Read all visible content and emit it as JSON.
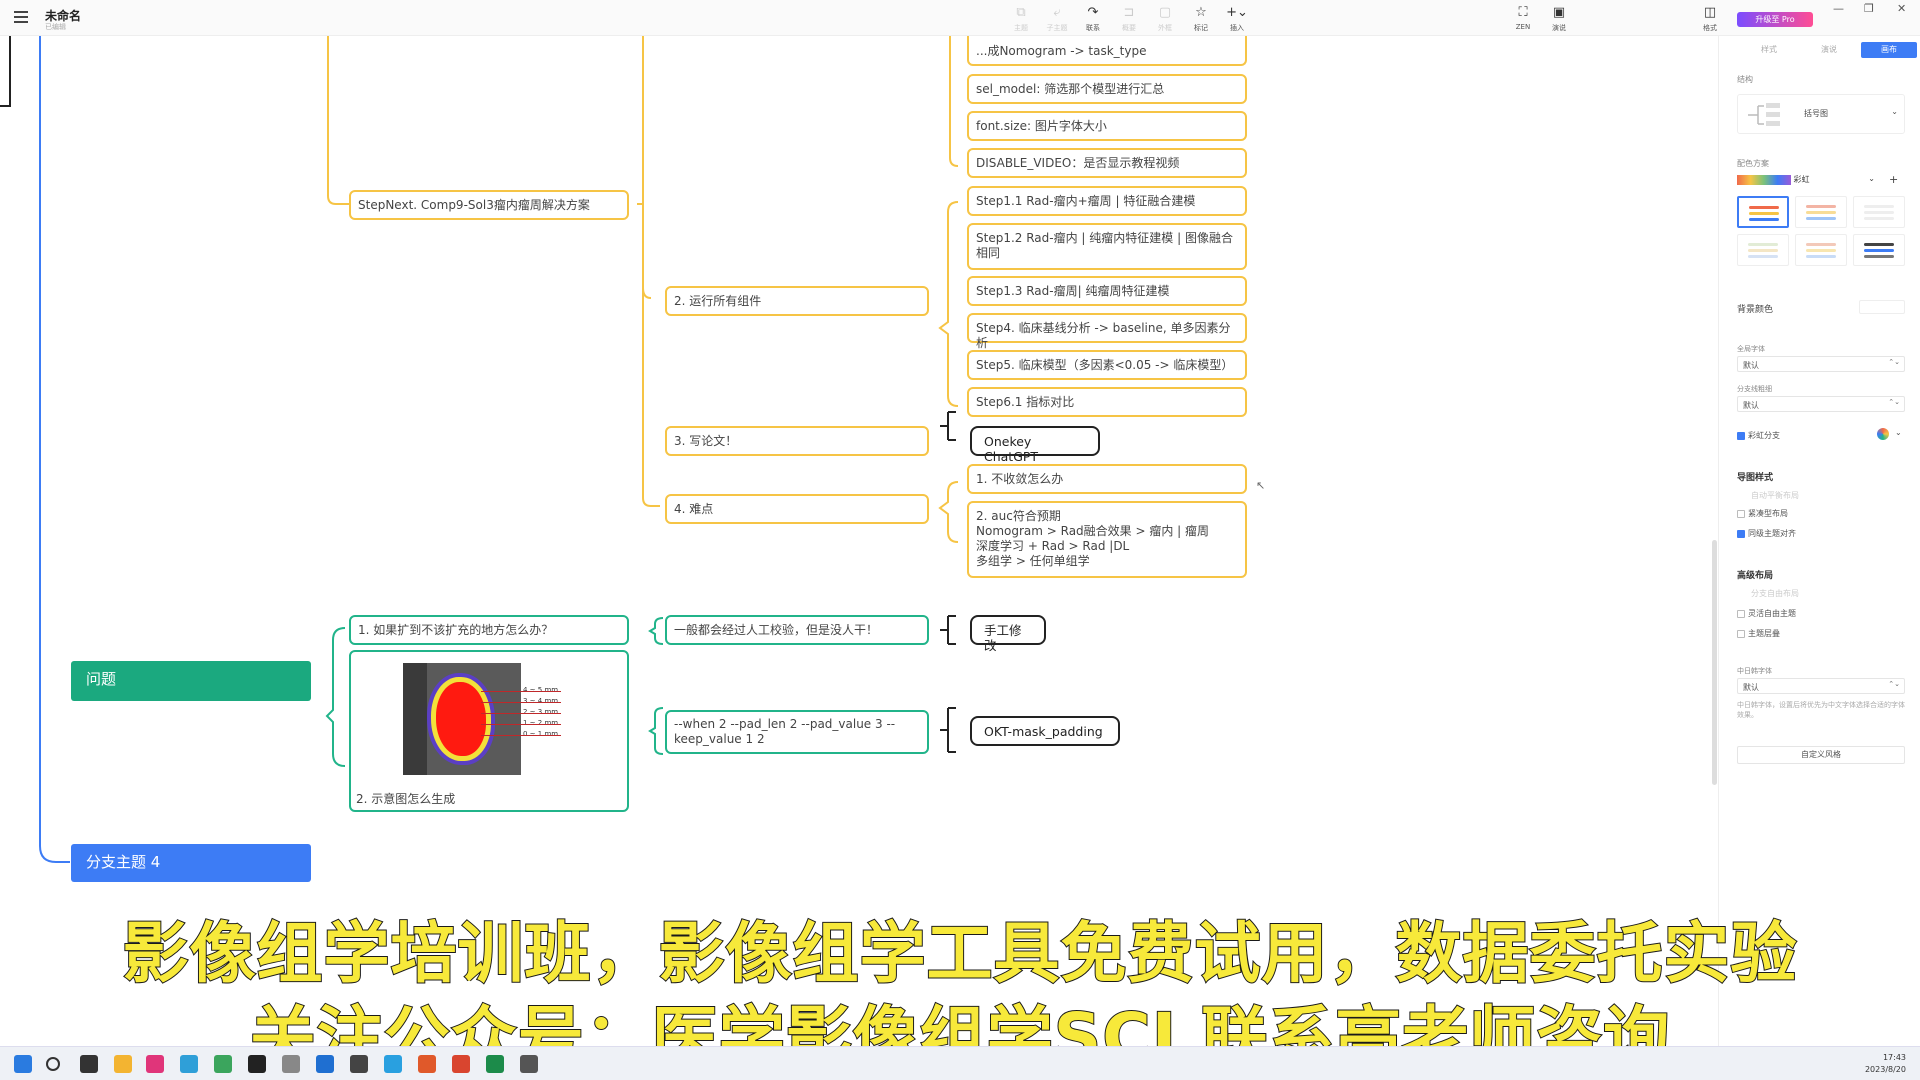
{
  "app": {
    "title": "未命名",
    "status": "已编辑",
    "upgrade_label": "升级至 Pro"
  },
  "toolbar": {
    "items": [
      {
        "icon": "subtopic-icon",
        "label": "主题",
        "glyph": "⧉"
      },
      {
        "icon": "child-topic-icon",
        "label": "子主题",
        "glyph": "⤶"
      },
      {
        "icon": "relation-icon",
        "label": "联系",
        "glyph": "↷"
      },
      {
        "icon": "summary-icon",
        "label": "概要",
        "glyph": "⊐"
      },
      {
        "icon": "boundary-icon",
        "label": "外框",
        "glyph": "▢"
      },
      {
        "icon": "marker-icon",
        "label": "标记",
        "glyph": "☆"
      },
      {
        "icon": "insert-icon",
        "label": "插入",
        "glyph": "+⌄"
      }
    ],
    "right_items": [
      {
        "icon": "zen-icon",
        "label": "ZEN",
        "glyph": "⛶"
      },
      {
        "icon": "present-icon",
        "label": "演说",
        "glyph": "▣"
      }
    ],
    "panel_toggle": {
      "icon": "panel-icon",
      "label": "格式",
      "glyph": "◫"
    },
    "window": {
      "minimize": "—",
      "restore": "❐",
      "close": "✕"
    }
  },
  "mindmap": {
    "nodes": {
      "stepnext": "StepNext. Comp9-Sol3瘤内瘤周解决方案",
      "task_type_line1": "...成Nomogram -> task_type",
      "sel_model": "sel_model: 筛选那个模型进行汇总",
      "font_size": "font.size: 图片字体大小",
      "disable_video": "DISABLE_VIDEO：是否显示教程视频",
      "run_all": "2. 运行所有组件",
      "step1_1": "Step1.1 Rad-瘤内+瘤周 | 特征融合建模",
      "step1_2_a": "Step1.2 Rad-瘤内 | 纯瘤内特征建模 | 图像融合",
      "step1_2_b": "相同",
      "step1_3": "Step1.3 Rad-瘤周| 纯瘤周特征建模",
      "step4": "Step4. 临床基线分析 -> baseline, 单多因素分析",
      "step5": "Step5. 临床模型（多因素<0.05 -> 临床模型）",
      "step6_1": "Step6.1 指标对比",
      "write_paper": "3. 写论文！",
      "onekey_chatgpt": "Onekey ChatGPT",
      "difficulty": "4. 难点",
      "not_converge": "1. 不收敛怎么办",
      "auc_1": "2. auc符合预期",
      "auc_2": " Nomogram >  Rad融合效果 > 瘤内 | 瘤周",
      "auc_3": "深度学习 + Rad > Rad |DL",
      "auc_4": "多组学 > 任何单组学",
      "issues_topic": "问题",
      "q1": "1. 如果扩到不该扩充的地方怎么办？",
      "q1_answer": "一般都会经过人工校验，但是没人干！",
      "manual_fix": "手工修改",
      "q2_caption": "2. 示意图怎么生成",
      "cmd_1": "--when 2 --pad_len 2 --pad_value 3 --",
      "cmd_2": "keep_value 1 2",
      "okt_mask": "OKT-mask_padding",
      "branch4": "分支主题 4"
    },
    "legend_mm": [
      "4 ~ 5 mm",
      "3 ~ 4 mm",
      "2 ~ 3 mm",
      "1 ~ 2 mm",
      "0 ~ 1 mm"
    ]
  },
  "panel": {
    "tabs": [
      "样式",
      "画布",
      "画布"
    ],
    "tab_labels": {
      "a": "样式",
      "b": "演说",
      "c": "画布"
    },
    "structure_label": "结构",
    "structure_value": "括号图",
    "color_scheme_label": "配色方案",
    "color_scheme_value": "彩虹",
    "bg_color_label": "背景颜色",
    "global_font_label": "全局字体",
    "global_font_value": "默认",
    "branch_line_label": "分支线粗细",
    "branch_line_value": "默认",
    "rainbow_branch_label": "彩虹分支",
    "map_style_title": "导图样式",
    "map_style_hint": "自动平衡布局",
    "compact_layout": "紧凑型布局",
    "align_same_level": "同级主题对齐",
    "advanced_title": "高级布局",
    "advanced_hint": "分支自由布局",
    "free_topic": "灵活自由主题",
    "topic_overlap": "主题层叠",
    "cjk_font_label": "中日韩字体",
    "cjk_font_value": "默认",
    "cjk_note": "中日韩字体，设置后将优先为中文字体选择合适的字体效果。",
    "custom_style_button": "自定义风格"
  },
  "subtitles": {
    "line1": "影像组学培训班，影像组学工具免费试用，数据委托实验",
    "line2": "关注公众号：医学影像组学SCI 联系高老师咨询"
  },
  "taskbar": {
    "time": "17:43",
    "date": "2023/8/20"
  },
  "colors": {
    "yellow_branch": "#f6c445",
    "teal_branch": "#21b48a",
    "blue_branch": "#3d7cf5",
    "issues_topic": "#1ba97f",
    "accent": "#3d7cf5"
  }
}
